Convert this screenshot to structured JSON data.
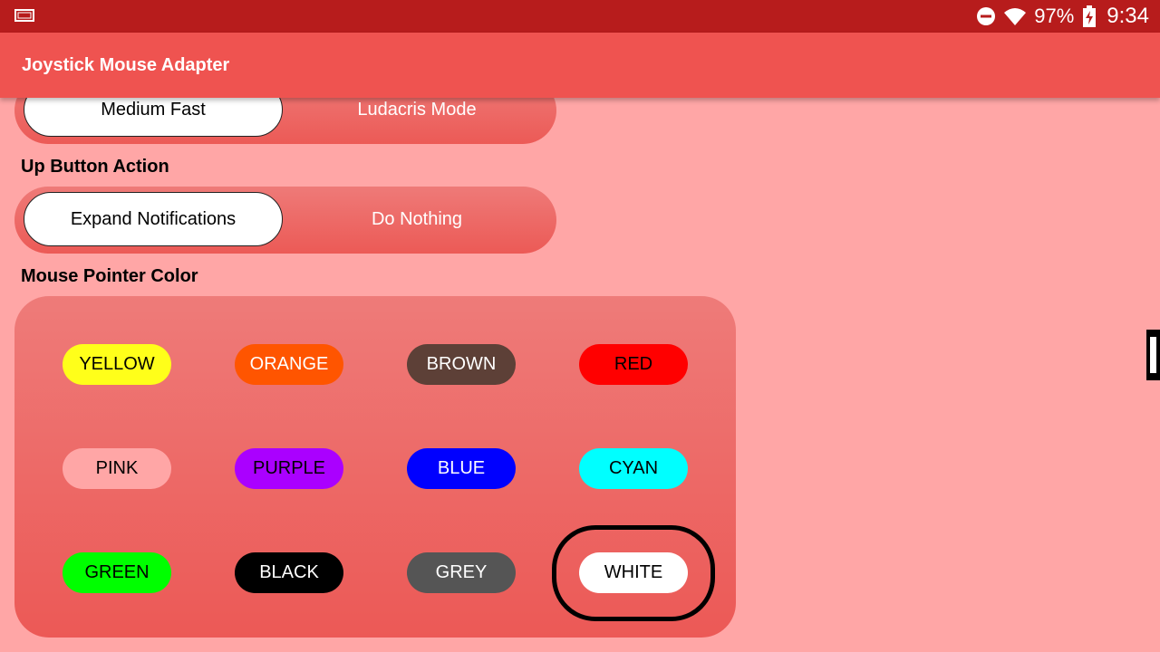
{
  "status_bar": {
    "battery": "97%",
    "time": "9:34",
    "icons": [
      "screen-icon",
      "do-not-disturb-icon",
      "wifi-icon",
      "battery-charging-icon"
    ]
  },
  "app_bar": {
    "title": "Joystick Mouse Adapter"
  },
  "speed": {
    "options": [
      "Medium Fast",
      "Ludacris Mode"
    ],
    "selected": "Medium Fast"
  },
  "up_button_action": {
    "label": "Up Button Action",
    "options": [
      "Expand Notifications",
      "Do Nothing"
    ],
    "selected": "Expand Notifications"
  },
  "mouse_pointer_color": {
    "label": "Mouse Pointer Color",
    "selected": "WHITE",
    "colors": [
      {
        "label": "YELLOW",
        "bg": "#ffff1a",
        "fg": "#000000"
      },
      {
        "label": "ORANGE",
        "bg": "#ff5500",
        "fg": "#ffffff"
      },
      {
        "label": "BROWN",
        "bg": "#5d4037",
        "fg": "#ffffff"
      },
      {
        "label": "RED",
        "bg": "#ff0000",
        "fg": "#000000"
      },
      {
        "label": "PINK",
        "bg": "#ffa6a6",
        "fg": "#000000"
      },
      {
        "label": "PURPLE",
        "bg": "#aa00ff",
        "fg": "#000000"
      },
      {
        "label": "BLUE",
        "bg": "#0000ff",
        "fg": "#ffffff"
      },
      {
        "label": "CYAN",
        "bg": "#00ffff",
        "fg": "#000000"
      },
      {
        "label": "GREEN",
        "bg": "#00ff00",
        "fg": "#000000"
      },
      {
        "label": "BLACK",
        "bg": "#000000",
        "fg": "#ffffff"
      },
      {
        "label": "GREY",
        "bg": "#555555",
        "fg": "#ffffff"
      },
      {
        "label": "WHITE",
        "bg": "#ffffff",
        "fg": "#000000"
      }
    ]
  },
  "theme": {
    "status_bar": "#b71c1c",
    "app_bar": "#ef5350",
    "background": "#ffa6a6",
    "panel": "#ec5a56"
  }
}
